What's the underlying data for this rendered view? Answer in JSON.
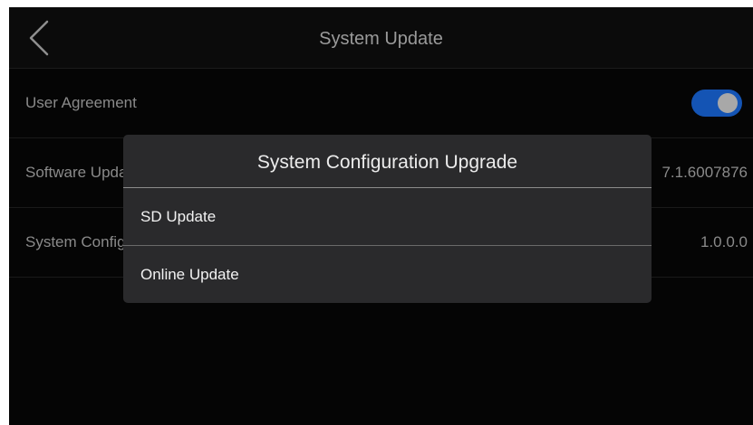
{
  "header": {
    "title": "System Update",
    "back_icon": "chevron-left-icon"
  },
  "settings": {
    "rows": [
      {
        "label": "User Agreement",
        "toggle_on": true
      },
      {
        "label": "Software Update",
        "value": "7.1.6007876"
      },
      {
        "label": "System Configuration Upgrade",
        "value": "1.0.0.0"
      }
    ]
  },
  "dialog": {
    "title": "System Configuration Upgrade",
    "options": [
      {
        "label": "SD Update"
      },
      {
        "label": "Online Update"
      }
    ]
  },
  "colors": {
    "background": "#050505",
    "toggle_on": "#1454b4",
    "dialog_bg": "#2a2a2c"
  }
}
